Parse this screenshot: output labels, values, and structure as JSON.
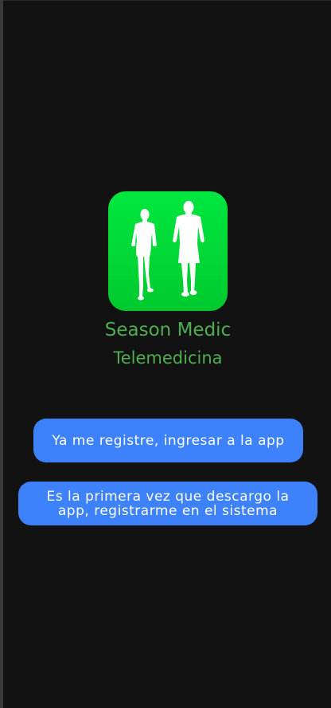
{
  "logo": {
    "icon": "two-people-walking-icon",
    "background_color": "#00dd38"
  },
  "app": {
    "name": "Season Medic",
    "subtitle": "Telemedicina"
  },
  "actions": {
    "login_label": "Ya me registre, ingresar a la app",
    "register_label": "Es la primera vez que descargo la app, registrarme en el sistema"
  },
  "colors": {
    "background": "#121212",
    "accent_text": "#4caf50",
    "button": "#3d82fb",
    "button_text": "#ffffff"
  }
}
